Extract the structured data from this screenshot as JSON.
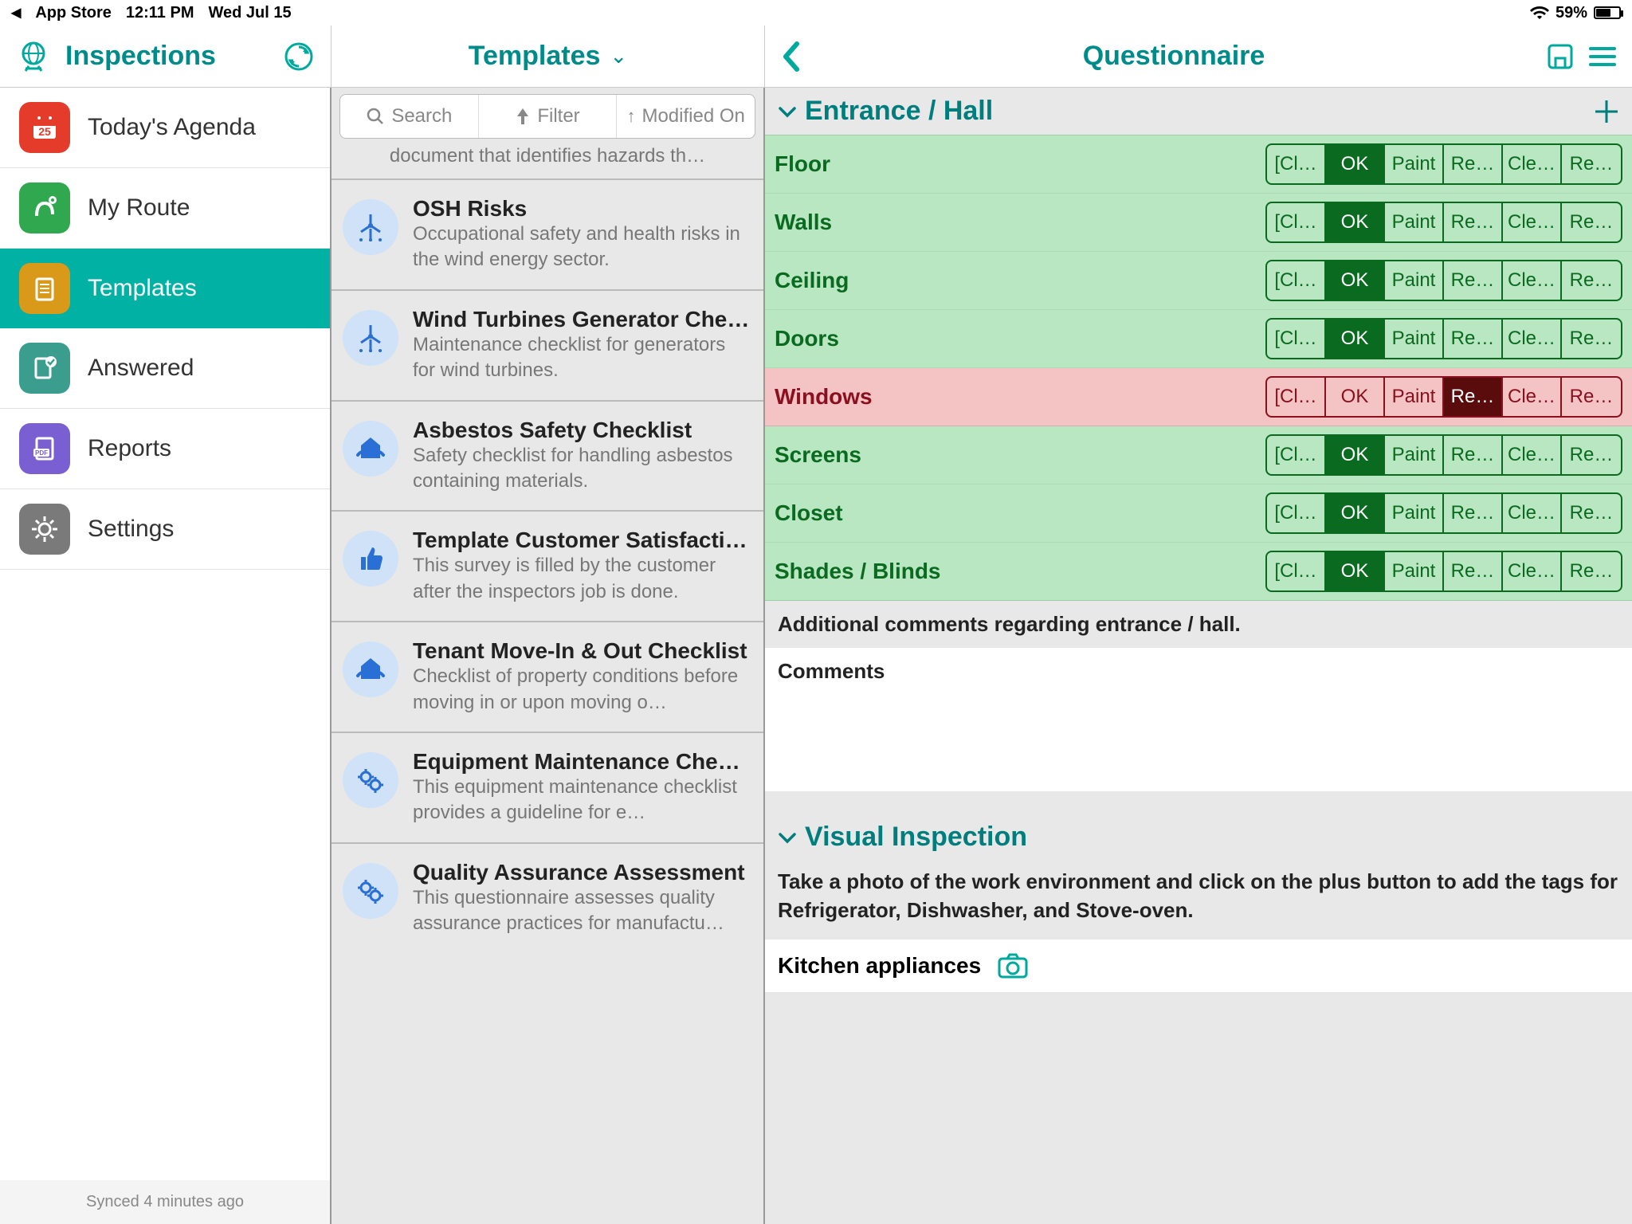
{
  "status": {
    "back_app": "App Store",
    "time": "12:11 PM",
    "date": "Wed Jul 15",
    "battery_pct": "59%"
  },
  "header": {
    "left_title": "Inspections",
    "mid_title": "Templates",
    "right_title": "Questionnaire"
  },
  "sidebar": {
    "items": [
      {
        "label": "Today's Agenda"
      },
      {
        "label": "My Route"
      },
      {
        "label": "Templates"
      },
      {
        "label": "Answered"
      },
      {
        "label": "Reports"
      },
      {
        "label": "Settings"
      }
    ],
    "sync_text": "Synced 4 minutes ago"
  },
  "searchbar": {
    "search": "Search",
    "filter": "Filter",
    "sort": "Modified On"
  },
  "clipped_text": "document that identifies hazards th…",
  "templates": [
    {
      "title": "OSH Risks",
      "desc": "Occupational safety and health risks in the wind energy sector."
    },
    {
      "title": "Wind Turbines Generator Chec…",
      "desc": "Maintenance checklist for generators for wind turbines."
    },
    {
      "title": "Asbestos Safety Checklist",
      "desc": "Safety checklist for handling asbestos containing materials."
    },
    {
      "title": "Template Customer Satisfactio…",
      "desc": "This survey is filled by the customer after the inspectors job is done."
    },
    {
      "title": "Tenant Move-In & Out Checklist",
      "desc": "Checklist of property conditions before moving in or upon moving o…"
    },
    {
      "title": "Equipment Maintenance Check…",
      "desc": "This equipment maintenance checklist provides a guideline for e…"
    },
    {
      "title": "Quality Assurance Assessment",
      "desc": "This questionnaire assesses quality assurance practices for manufactu…"
    }
  ],
  "section1": {
    "title": "Entrance / Hall",
    "options": [
      "[Cl…",
      "OK",
      "Paint",
      "Re…",
      "Cle…",
      "Re…"
    ],
    "rows": [
      {
        "label": "Floor",
        "sel": 1,
        "bad": false
      },
      {
        "label": "Walls",
        "sel": 1,
        "bad": false
      },
      {
        "label": "Ceiling",
        "sel": 1,
        "bad": false
      },
      {
        "label": "Doors",
        "sel": 1,
        "bad": false
      },
      {
        "label": "Windows",
        "sel": 3,
        "bad": true
      },
      {
        "label": "Screens",
        "sel": 1,
        "bad": false
      },
      {
        "label": "Closet",
        "sel": 1,
        "bad": false
      },
      {
        "label": "Shades / Blinds",
        "sel": 1,
        "bad": false
      }
    ],
    "comments_label": "Additional comments regarding entrance / hall.",
    "comments_placeholder": "Comments"
  },
  "section2": {
    "title": "Visual Inspection",
    "desc": "Take a photo of the work environment and click on the plus button to add the tags for Refrigerator, Dishwasher, and Stove-oven.",
    "photo_label": "Kitchen appliances"
  }
}
